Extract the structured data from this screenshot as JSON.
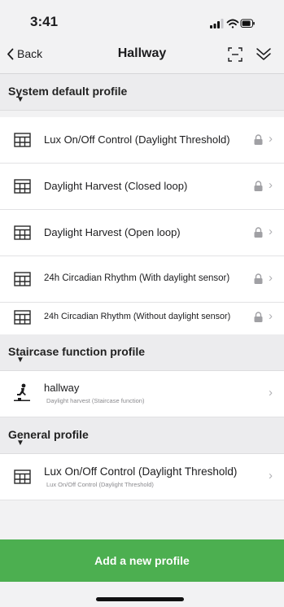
{
  "status": {
    "time": "3:41"
  },
  "nav": {
    "back_label": "Back",
    "title": "Hallway"
  },
  "sections": [
    {
      "title": "System default profile"
    },
    {
      "title": "Staircase function profile"
    },
    {
      "title": "General profile"
    }
  ],
  "system_rows": [
    {
      "label": "Lux On/Off Control (Daylight Threshold)",
      "locked": true
    },
    {
      "label": "Daylight Harvest (Closed loop)",
      "locked": true
    },
    {
      "label": "Daylight Harvest (Open loop)",
      "locked": true
    },
    {
      "label": "24h Circadian Rhythm (With daylight sensor)",
      "locked": true
    },
    {
      "label": "24h Circadian Rhythm (Without daylight sensor)",
      "locked": true
    }
  ],
  "staircase_rows": [
    {
      "label": "hallway",
      "sublabel": "Daylight harvest (Staircase function)"
    }
  ],
  "general_rows": [
    {
      "label": "Lux On/Off Control (Daylight Threshold)",
      "sublabel": "Lux On/Off Control (Daylight Threshold)"
    }
  ],
  "add_button_label": "Add a new profile",
  "icons": {
    "profile": "lamp-grid-icon",
    "staircase": "stair-runner-icon",
    "lock": "lock-icon",
    "chevron": "chevron-right-icon",
    "scan": "scan-frame-icon",
    "collapse": "double-chevron-down-icon"
  },
  "colors": {
    "accent": "#4caf50",
    "section_bg": "#ececee"
  }
}
